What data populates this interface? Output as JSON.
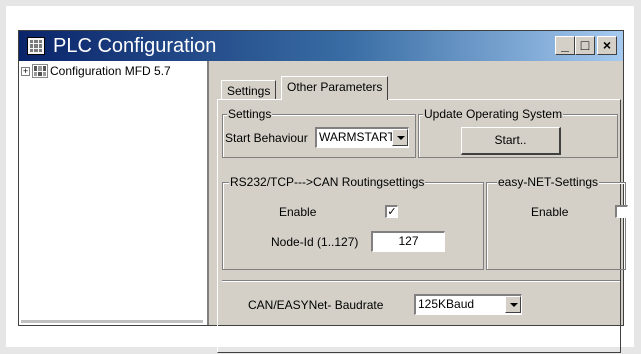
{
  "window": {
    "title": "PLC Configuration",
    "buttons": {
      "minimize": "_",
      "maximize": "□",
      "close": "×"
    }
  },
  "tree": {
    "expander": "+",
    "items": [
      {
        "label": "Configuration MFD 5.7"
      }
    ]
  },
  "tabs": [
    {
      "label": "Settings",
      "active": false
    },
    {
      "label": "Other Parameters",
      "active": true
    }
  ],
  "settings_group": {
    "title": "Settings",
    "start_behaviour_label": "Start Behaviour",
    "start_behaviour_value": "WARMSTART"
  },
  "update_os_group": {
    "title": "Update Operating System",
    "start_button": "Start.."
  },
  "routing_group": {
    "title": "RS232/TCP--->CAN Routingsettings",
    "enable_label": "Enable",
    "enable_checked": true,
    "enable_mark": "✓",
    "node_id_label": "Node-Id (1..127)",
    "node_id_value": "127"
  },
  "easynet_group": {
    "title": "easy-NET-Settings",
    "enable_label": "Enable",
    "enable_checked": false
  },
  "baudrate": {
    "label": "CAN/EASYNet- Baudrate",
    "value": "125KBaud"
  }
}
